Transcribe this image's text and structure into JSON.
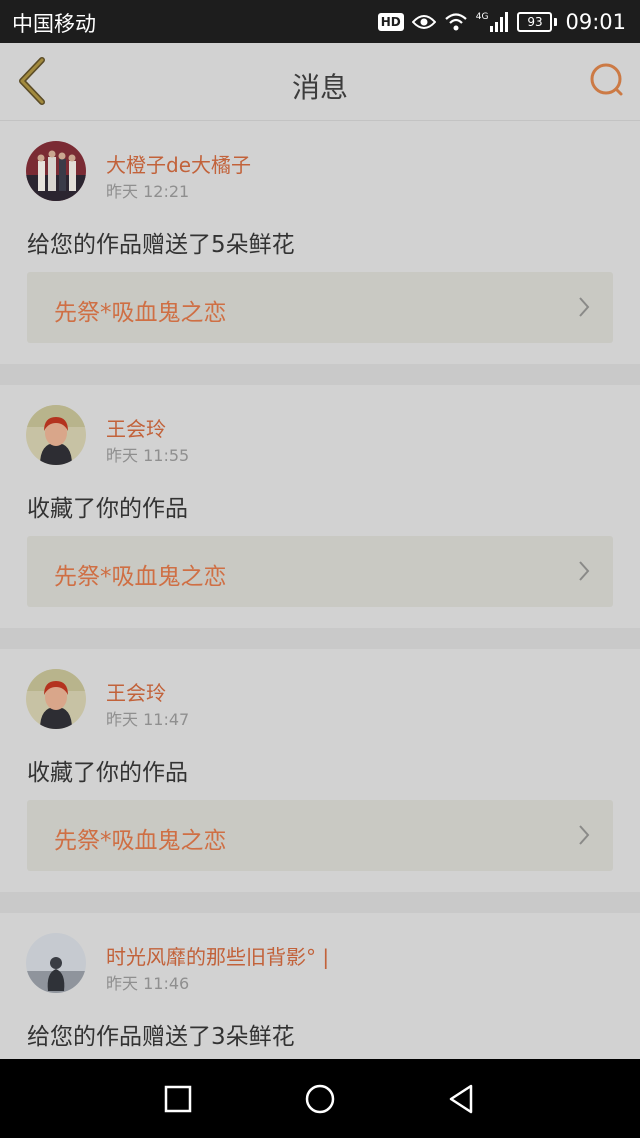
{
  "status_bar": {
    "carrier": "中国移动",
    "hd_badge": "HD",
    "network": "4G",
    "battery": "93",
    "time": "09:01"
  },
  "header": {
    "title": "消息",
    "back_icon": "chevron-left-icon",
    "search_icon": "search-icon"
  },
  "colors": {
    "accent": "#c2623a",
    "link_text": "#cf6f44",
    "card_bg": "#d2d2d2"
  },
  "messages": [
    {
      "user": "大橙子de大橘子",
      "time": "昨天 12:21",
      "action": "给您的作品赠送了5朵鲜花",
      "work": "先祭*吸血鬼之恋"
    },
    {
      "user": "王会玲",
      "time": "昨天 11:55",
      "action": "收藏了你的作品",
      "work": "先祭*吸血鬼之恋"
    },
    {
      "user": "王会玲",
      "time": "昨天 11:47",
      "action": "收藏了你的作品",
      "work": "先祭*吸血鬼之恋"
    },
    {
      "user": "时光风靡的那些旧背影° |",
      "time": "昨天 11:46",
      "action": "给您的作品赠送了3朵鲜花"
    }
  ],
  "nav_bar": {
    "buttons": [
      "recents-icon",
      "home-icon",
      "back-triangle-icon"
    ]
  }
}
